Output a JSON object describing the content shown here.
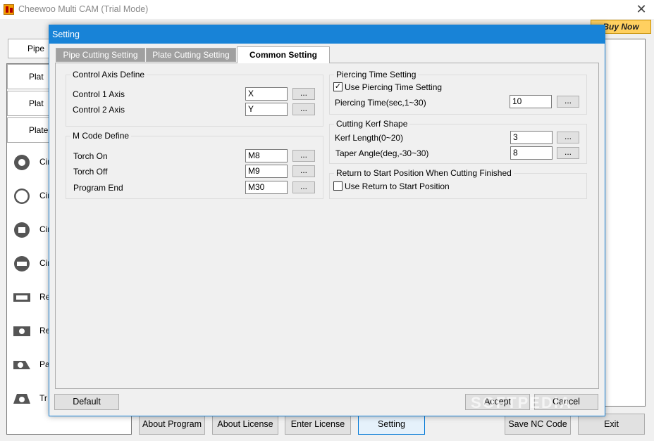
{
  "main": {
    "title": "Cheewoo Multi CAM (Trial Mode)",
    "buy_now": "Buy Now",
    "pipe_tab": "Pipe",
    "left_buttons": [
      "Plat",
      "Plat",
      "Plate"
    ],
    "shapes": [
      "Cir",
      "Cir",
      "Cir",
      "Cir",
      "Re",
      "Re",
      "Pa",
      "Tr"
    ],
    "bottom_buttons": {
      "about_program": "About Program",
      "about_license": "About License",
      "enter_license": "Enter License",
      "setting": "Setting",
      "save_nc_code": "Save NC Code",
      "exit": "Exit"
    }
  },
  "dialog": {
    "title": "Setting",
    "tabs": [
      "Pipe Cutting Setting",
      "Plate Cutting Setting",
      "Common Setting"
    ],
    "control_axis": {
      "title": "Control Axis Define",
      "axis1_label": "Control 1 Axis",
      "axis1_value": "X",
      "axis2_label": "Control 2 Axis",
      "axis2_value": "Y"
    },
    "m_code": {
      "title": "M Code Define",
      "torch_on_label": "Torch On",
      "torch_on_value": "M8",
      "torch_off_label": "Torch Off",
      "torch_off_value": "M9",
      "program_end_label": "Program End",
      "program_end_value": "M30"
    },
    "piercing": {
      "title": "Piercing Time Setting",
      "use_label": "Use Piercing Time Setting",
      "time_label": "Piercing Time(sec,1~30)",
      "time_value": "10"
    },
    "kerf": {
      "title": "Cutting Kerf Shape",
      "length_label": "Kerf Length(0~20)",
      "length_value": "3",
      "angle_label": "Taper Angle(deg,-30~30)",
      "angle_value": "8"
    },
    "return_start": {
      "title": "Return to Start Position When Cutting Finished",
      "use_label": "Use Return to Start Position"
    },
    "dots": "...",
    "check_mark": "✓",
    "default_btn": "Default",
    "accept_btn": "Accept",
    "cancel_btn": "Cancel"
  },
  "watermark": "SOFTPEDIA"
}
